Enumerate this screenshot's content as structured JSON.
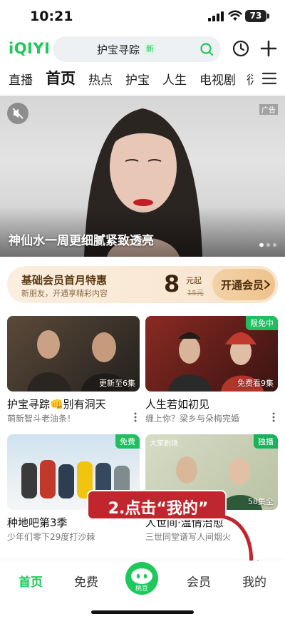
{
  "status_bar": {
    "time": "10:21",
    "battery": "73"
  },
  "header": {
    "logo": "iQIYI",
    "search_keyword": "护宝寻踪",
    "search_badge": "新"
  },
  "tabs": [
    "直播",
    "首页",
    "热点",
    "护宝",
    "人生",
    "电视剧",
    "衍"
  ],
  "active_tab": "首页",
  "hero": {
    "title": "神仙水一周更细腻紧致透亮",
    "ad_tag": "广告",
    "slide_index": 1,
    "slide_count": 3
  },
  "vip_banner": {
    "title": "基础会员首月特惠",
    "subtitle": "新朋友，开通享精彩内容",
    "price": "8",
    "price_unit": "元起",
    "original_price": "15元",
    "button_label": "开通会员"
  },
  "cards": [
    {
      "title": "护宝寻踪👊别有洞天",
      "subtitle": "萌新智斗老油条！",
      "episode": "更新至6集",
      "badge": ""
    },
    {
      "title": "人生若如初见",
      "subtitle": "缠上你？梁乡与朵梅完婚",
      "episode": "免费看9集",
      "badge": "限免中"
    },
    {
      "title": "种地吧第3季",
      "subtitle": "少年们零下29度打沙棘",
      "episode": "",
      "badge": "免费"
    },
    {
      "title": "人世间·温情治愈",
      "subtitle": "三世同堂谱写人间烟火",
      "episode": "58集全",
      "badge": "独播",
      "thumb_text": "大家剧场"
    }
  ],
  "annotation": {
    "text": "2.点击“我的”"
  },
  "bottom_nav": {
    "items": [
      "首页",
      "免费",
      "会员",
      "我的"
    ],
    "center_label": "桃豆",
    "active": "首页"
  },
  "colors": {
    "brand_green": "#1ec85a",
    "annotation_red": "#c0262d",
    "vip_gold": "#eec28c"
  }
}
